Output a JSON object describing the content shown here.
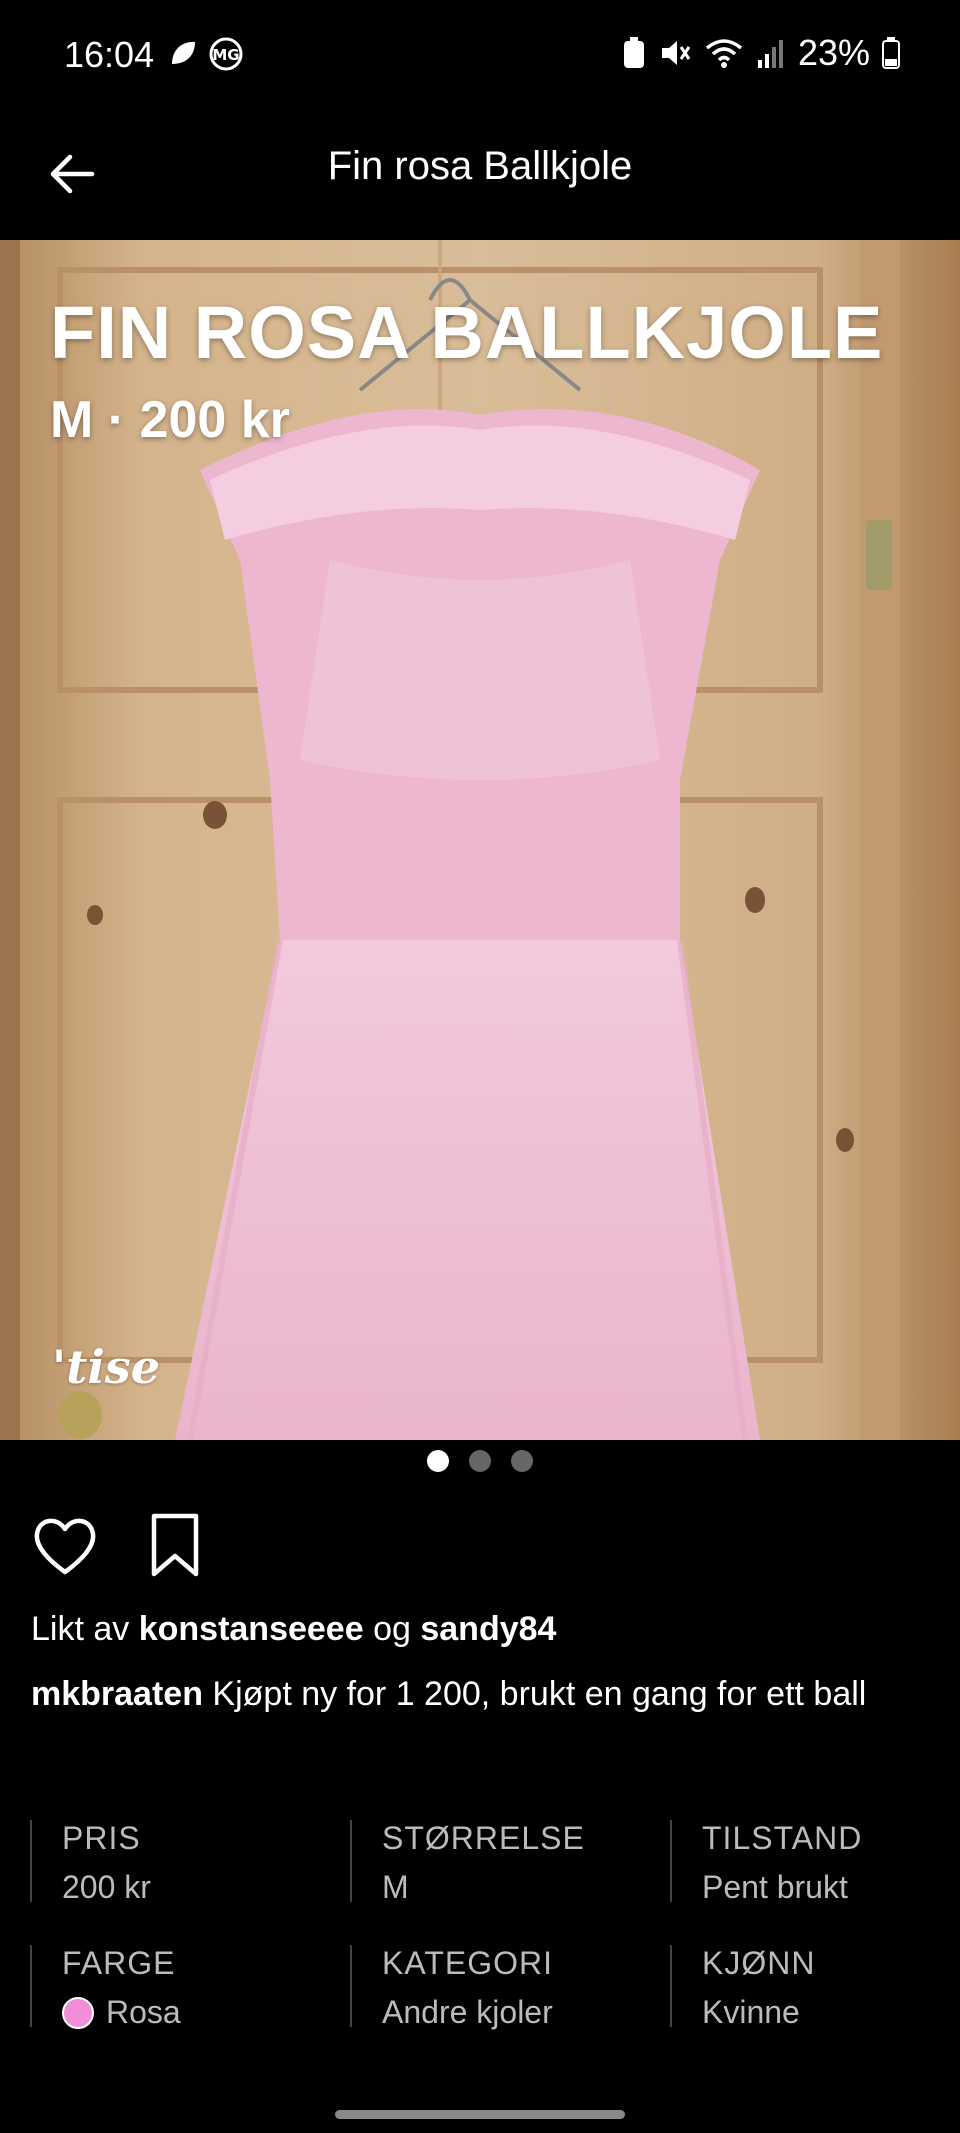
{
  "status": {
    "time": "16:04",
    "battery": "23%"
  },
  "appbar": {
    "title": "Fin rosa Ballkjole"
  },
  "listing": {
    "title": "FIN ROSA BALLKJOLE",
    "subtitle": "M · 200 kr",
    "brand": "'tise",
    "image_count": 3,
    "active_image": 1
  },
  "likes": {
    "prefix": "Likt av",
    "user1": "konstanseeee",
    "conj": "og",
    "user2": "sandy84"
  },
  "description": {
    "user": "mkbraaten",
    "text": "Kjøpt ny for 1 200, brukt en gang for ett ball"
  },
  "details": {
    "pris_label": "PRIS",
    "pris_value": "200 kr",
    "storrelse_label": "STØRRELSE",
    "storrelse_value": "M",
    "tilstand_label": "TILSTAND",
    "tilstand_value": "Pent brukt",
    "farge_label": "FARGE",
    "farge_value": "Rosa",
    "farge_color": "#f08fd8",
    "kategori_label": "KATEGORI",
    "kategori_value": "Andre kjoler",
    "kjonn_label": "KJØNN",
    "kjonn_value": "Kvinne"
  }
}
